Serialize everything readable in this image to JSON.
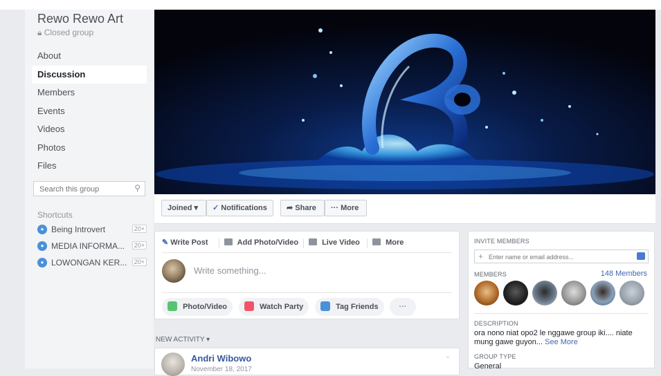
{
  "group": {
    "name": "Rewo Rewo Art",
    "privacy": "Closed group"
  },
  "nav": {
    "items": [
      "About",
      "Discussion",
      "Members",
      "Events",
      "Videos",
      "Photos",
      "Files"
    ],
    "active": "Discussion"
  },
  "search": {
    "placeholder": "Search this group"
  },
  "shortcuts": {
    "heading": "Shortcuts",
    "items": [
      {
        "label": "Being Introvert",
        "badge": "20+"
      },
      {
        "label": "MEDIA INFORMA...",
        "badge": "20+"
      },
      {
        "label": "LOWONGAN KER...",
        "badge": "20+"
      }
    ]
  },
  "actions": {
    "joined": "Joined",
    "notifications": "Notifications",
    "share": "Share",
    "more": "More"
  },
  "composer": {
    "tabs": [
      "Write Post",
      "Add Photo/Video",
      "Live Video",
      "More"
    ],
    "placeholder": "Write something...",
    "options": [
      "Photo/Video",
      "Watch Party",
      "Tag Friends"
    ]
  },
  "feed": {
    "heading": "NEW ACTIVITY",
    "first_post": {
      "author": "Andri Wibowo",
      "date": "November 18, 2017"
    }
  },
  "invite": {
    "heading": "INVITE MEMBERS",
    "placeholder": "Enter name or email address..."
  },
  "members": {
    "heading": "MEMBERS",
    "count": "148 Members"
  },
  "description": {
    "heading": "DESCRIPTION",
    "text": "ora nono niat opo2 le nggawe group iki.... niate mung gawe guyon...",
    "see_more": "See More"
  },
  "group_type": {
    "heading": "GROUP TYPE",
    "value": "General"
  },
  "colors": {
    "link": "#4267b2",
    "background": "#e9ebee",
    "cover_dark": "#05050f",
    "cover_blue": "#2a6fd6"
  }
}
